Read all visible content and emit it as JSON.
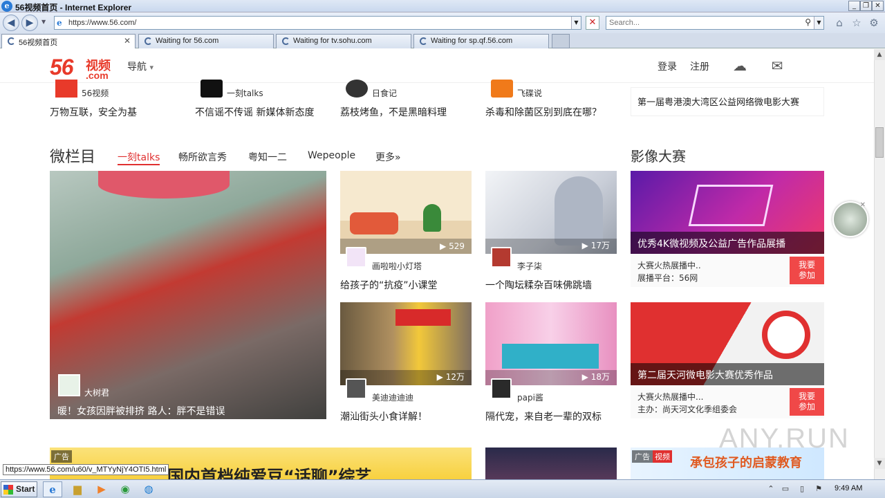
{
  "window": {
    "title": "56视频首页 - Internet Explorer",
    "controls": [
      "_",
      "❐",
      "✕"
    ]
  },
  "toolbar": {
    "back": "◀",
    "forward": "▶",
    "address": "https://www.56.com/",
    "search_placeholder": "Search..."
  },
  "tabs": [
    {
      "label": "56视频首页",
      "active": true,
      "close": "✕"
    },
    {
      "label": "Waiting for 56.com",
      "active": false
    },
    {
      "label": "Waiting for tv.sohu.com",
      "active": false
    },
    {
      "label": "Waiting for sp.qf.56.com",
      "active": false
    }
  ],
  "header": {
    "logo_number": "56",
    "logo_cn": "视频",
    "logo_com": ".com",
    "nav_label": "导航",
    "nav_arrow": "▾",
    "login": "登录",
    "register": "注册"
  },
  "channels": [
    {
      "name": "56视频",
      "story": "万物互联，安全为基"
    },
    {
      "name": "一刻talks",
      "story": "不信谣不传谣 新媒体新态度"
    },
    {
      "name": "日食记",
      "story": "荔枝烤鱼，不是黑暗料理"
    },
    {
      "name": "飞碟说",
      "story": "杀毒和除菌区别到底在哪？"
    }
  ],
  "sidebar_top": "第一届粤港澳大湾区公益网络微电影大赛",
  "section": {
    "title": "微栏目",
    "tabs": [
      "一刻talks",
      "畅所欲言秀",
      "粤知一二",
      "Wepeople",
      "更多»"
    ],
    "big": {
      "user": "大树君",
      "caption": "暖！女孩因胖被排挤 路人：胖不是错误"
    },
    "cards": [
      {
        "count": "529",
        "user": "画啦啦小灯塔",
        "caption": "给孩子的“抗疫”小课堂"
      },
      {
        "count": "17万",
        "user": "李子柒",
        "caption": "一个陶坛糅杂百味佛跳墙"
      },
      {
        "count": "12万",
        "user": "美迪迪迪迪",
        "caption": "潮汕街头小食详解！"
      },
      {
        "count": "18万",
        "user": "papi酱",
        "caption": "隔代宠，来自老一辈的双标"
      }
    ]
  },
  "contest": {
    "title": "影像大赛",
    "items": [
      {
        "banner": "优秀4K微视频及公益广告作品展播",
        "line1": "大赛火热展播中..",
        "line2": "展播平台：56网",
        "join": "我要\n参加"
      },
      {
        "banner": "第二届天河微电影大赛优秀作品",
        "line1": "大赛火热展播中...",
        "line2": "主办：尚天河文化季组委会",
        "join": "我要\n参加"
      }
    ]
  },
  "ads": {
    "tag": "广告",
    "banner_text": "国内首档纯爱豆“话聊”综艺",
    "right_tag": "视频",
    "right_text": "承包孩子的启蒙教育"
  },
  "status_url": "https://www.56.com/u60/v_MTYyNjY4OTI5.html",
  "taskbar": {
    "start": "Start",
    "clock": "9:49 AM"
  },
  "watermark": "ANY.RUN"
}
